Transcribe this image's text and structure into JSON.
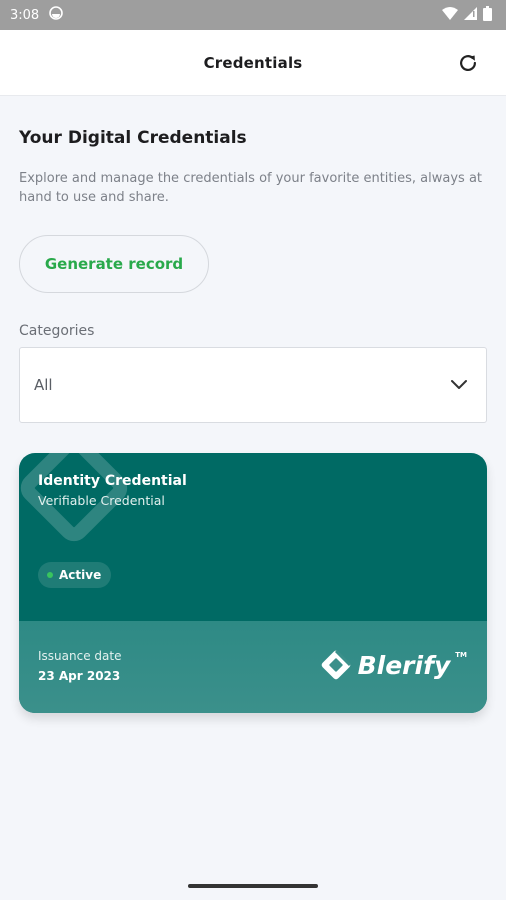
{
  "status_bar": {
    "time": "3:08",
    "icons": [
      "notification-icon",
      "wifi-icon",
      "signal-icon",
      "battery-icon"
    ]
  },
  "app_bar": {
    "title": "Credentials",
    "refresh_icon": "refresh-icon"
  },
  "main": {
    "heading": "Your Digital Credentials",
    "description": "Explore and manage the credentials of your favorite entities, always at hand to use and share.",
    "generate_button": "Generate record",
    "categories_label": "Categories",
    "categories_selected": "All"
  },
  "credential_card": {
    "title": "Identity Credential",
    "subtitle": "Verifiable Credential",
    "status": "Active",
    "issuance_label": "Issuance date",
    "issuance_date": "23 Apr 2023",
    "brand": "Blerify",
    "brand_tm": "TM"
  },
  "colors": {
    "accent_green": "#29a94b",
    "card_teal": "#006a64",
    "status_green": "#39c45e"
  }
}
